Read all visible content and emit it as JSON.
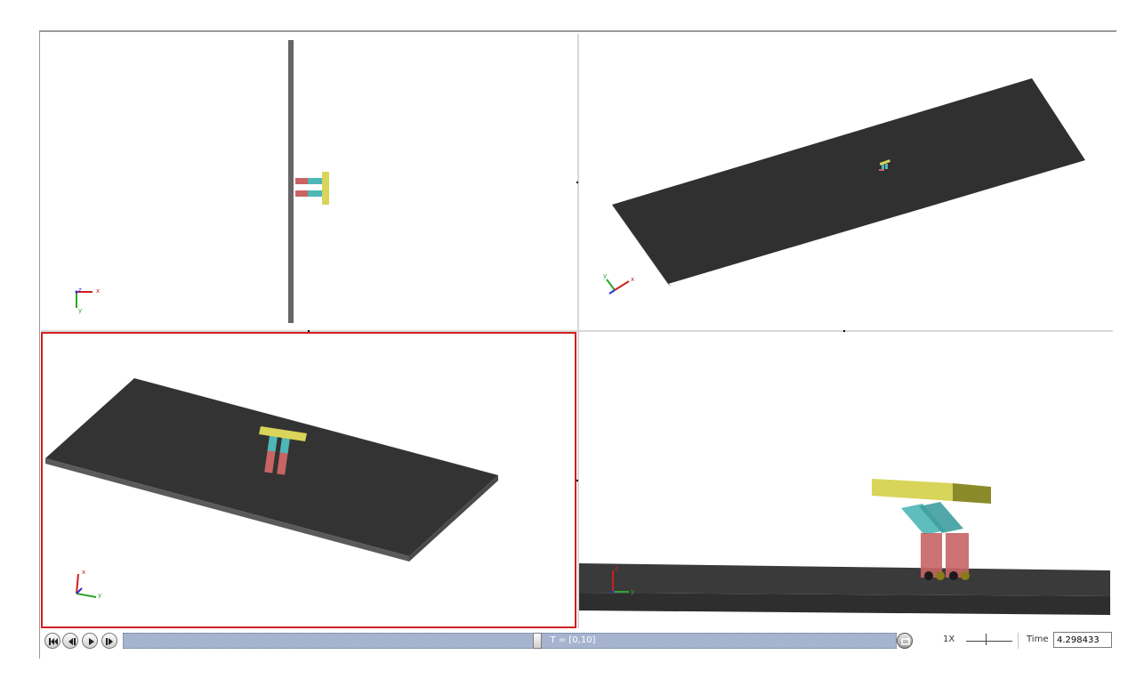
{
  "viewports": [
    {
      "id": "front",
      "axis_labels": [
        "z",
        "x",
        "y"
      ]
    },
    {
      "id": "perspective",
      "axis_labels": [
        "y",
        "x"
      ]
    },
    {
      "id": "iso",
      "axis_labels": [
        "x",
        "y"
      ]
    },
    {
      "id": "side",
      "axis_labels": [
        "z",
        "y"
      ]
    }
  ],
  "active_viewport": "iso",
  "playback": {
    "buttons": [
      "rewind",
      "step-back",
      "play",
      "step-forward"
    ],
    "progress": 0.43,
    "time_range_label": "T = [0,10]",
    "speed_label": "1X",
    "time_label": "Time",
    "time_value": "4.298433"
  },
  "colors": {
    "platform_dark": "#333333",
    "platform_edge": "#555555",
    "body_yellow": "#d9d45a",
    "leg_red": "#c86464",
    "leg_cyan": "#4fb6b6",
    "active_border": "#d32020",
    "timeline": "#a6b4d0"
  }
}
